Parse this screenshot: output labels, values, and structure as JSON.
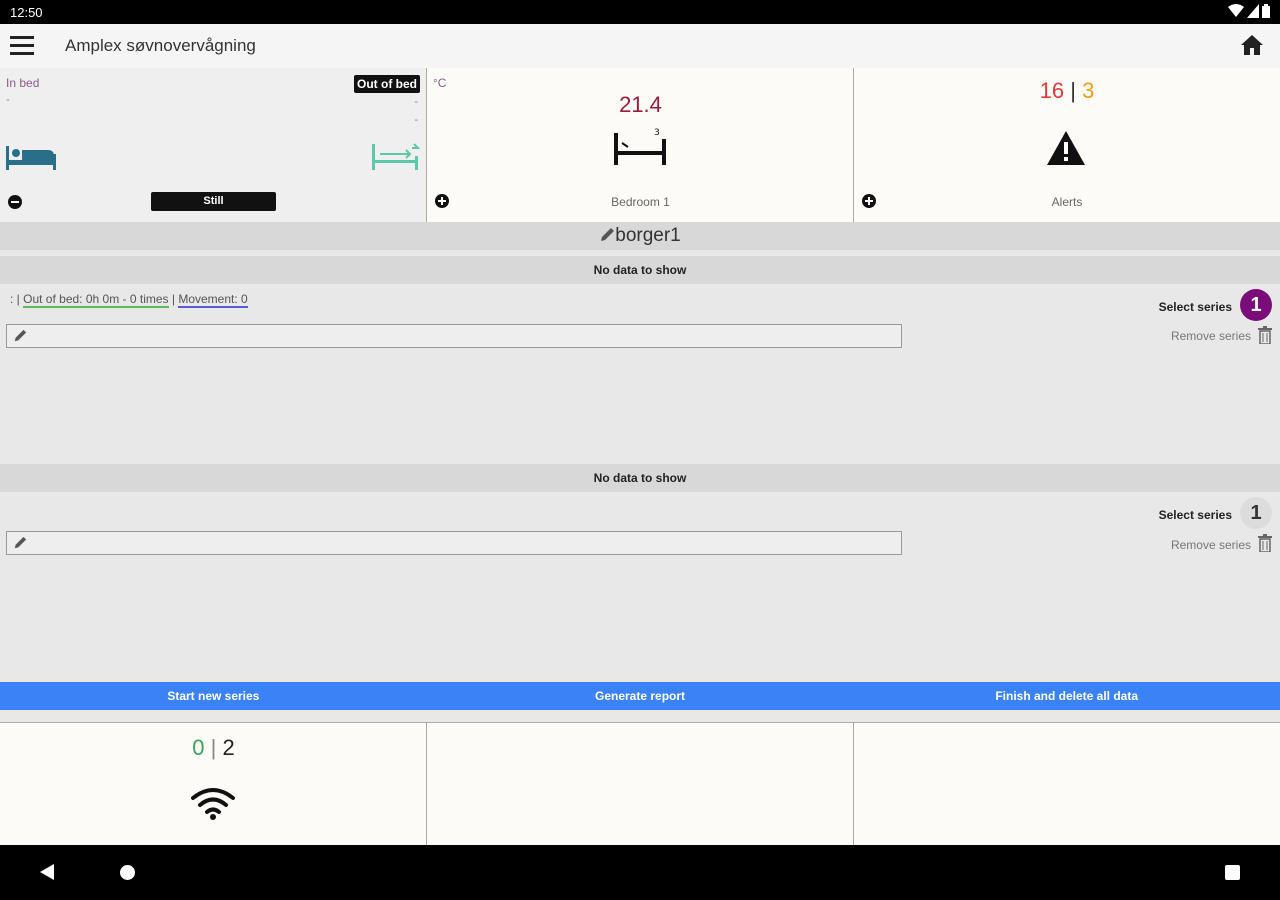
{
  "status_bar": {
    "time": "12:50"
  },
  "app_bar": {
    "title": "Amplex søvnovervågning",
    "menu_icon": "hamburger-menu-icon",
    "home_icon": "home-icon"
  },
  "tiles": {
    "bed": {
      "in_bed_label": "In bed",
      "in_bed_value": "-",
      "out_of_bed_label": "Out of bed",
      "out_value_1": "-",
      "out_value_2": "-",
      "state": "Still"
    },
    "temperature": {
      "unit": "°C",
      "value": "21.4",
      "room": "Bedroom 1"
    },
    "alerts": {
      "count_a": "16",
      "separator": "|",
      "count_b": "3",
      "label": "Alerts"
    }
  },
  "user": {
    "name": "borger1"
  },
  "series": [
    {
      "no_data": "No data to show",
      "stats_prefix": ": | ",
      "out_of_bed": "Out of bed: 0h 0m - 0 times",
      "stats_sep": " | ",
      "movement": "Movement: 0",
      "select_label": "Select series",
      "badge": "1",
      "badge_color": "#7b0d7b",
      "remove_label": "Remove series"
    },
    {
      "no_data": "No data to show",
      "select_label": "Select series",
      "badge": "1",
      "badge_color": "#dcdcdc",
      "remove_label": "Remove series"
    }
  ],
  "actions": {
    "start": "Start new series",
    "report": "Generate report",
    "finish": "Finish and delete all data"
  },
  "wifi": {
    "count_a": "0",
    "separator": "|",
    "count_b": "2"
  }
}
